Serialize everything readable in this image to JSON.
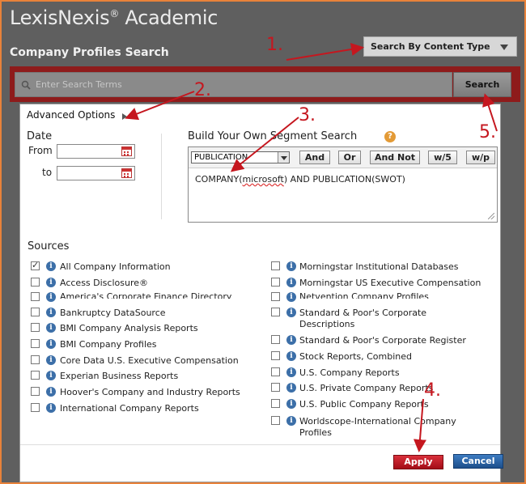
{
  "brand": {
    "name": "LexisNexis",
    "reg": "®",
    "suffix": " Academic"
  },
  "page_title": "Company Profiles Search",
  "content_type_button": "Search By Content Type",
  "search": {
    "placeholder": "Enter Search Terms",
    "button": "Search"
  },
  "advanced_options": "Advanced Options",
  "date": {
    "label": "Date",
    "from": "From",
    "to": "to"
  },
  "segment": {
    "title": "Build Your Own Segment Search",
    "help": "?",
    "selected_segment": "PUBLICATION",
    "operators": [
      "And",
      "Or",
      "And Not",
      "w/5",
      "w/p"
    ],
    "query_prefix": "COMPANY(",
    "query_misspelled": "microsoft",
    "query_suffix": ") AND PUBLICATION(SWOT)"
  },
  "sources": {
    "title": "Sources",
    "left": [
      {
        "label": "All Company Information",
        "checked": true
      },
      {
        "label": "Access Disclosure®",
        "checked": false
      },
      {
        "label": "America's Corporate Finance Directory",
        "checked": false
      },
      {
        "label": "Bankruptcy DataSource",
        "checked": false
      },
      {
        "label": "BMI Company Analysis Reports",
        "checked": false
      },
      {
        "label": "BMI Company Profiles",
        "checked": false
      },
      {
        "label": "Core Data U.S. Executive Compensation",
        "checked": false
      },
      {
        "label": "Experian Business Reports",
        "checked": false
      },
      {
        "label": "Hoover's Company and Industry Reports",
        "checked": false
      },
      {
        "label": "International Company Reports",
        "checked": false
      }
    ],
    "right": [
      {
        "label": "Morningstar Institutional Databases",
        "checked": false
      },
      {
        "label": "Morningstar US Executive Compensation",
        "checked": false
      },
      {
        "label": "Netvention Company Profiles",
        "checked": false
      },
      {
        "label": "Standard & Poor's Corporate Descriptions",
        "checked": false
      },
      {
        "label": "Standard & Poor's Corporate Register",
        "checked": false
      },
      {
        "label": "Stock Reports, Combined",
        "checked": false
      },
      {
        "label": "U.S. Company Reports",
        "checked": false
      },
      {
        "label": "U.S. Private Company Reports",
        "checked": false
      },
      {
        "label": "U.S. Public Company Reports",
        "checked": false
      },
      {
        "label": "Worldscope-International Company Profiles",
        "checked": false
      }
    ]
  },
  "buttons": {
    "apply": "Apply",
    "cancel": "Cancel"
  },
  "annotations": [
    "1.",
    "2.",
    "3.",
    "4.",
    "5."
  ],
  "colors": {
    "frame": "#e8823a",
    "search_band": "#8e1b1b",
    "apply": "#c11f2a",
    "cancel": "#2a64a8",
    "annotation": "#c5171f"
  }
}
